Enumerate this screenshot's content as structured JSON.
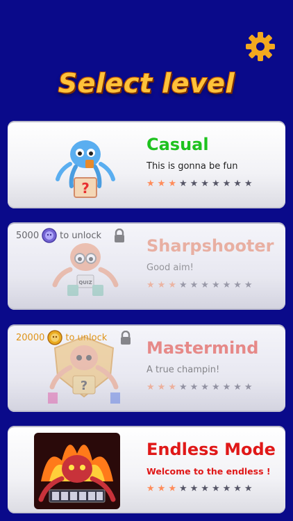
{
  "header": {
    "title": "Select level",
    "settings_icon": "gear-icon",
    "title_color": "#ffc23a"
  },
  "levels": [
    {
      "name": "Casual",
      "description": "This is gonna be fun",
      "name_color": "#1fc21f",
      "desc_color": "#222222",
      "difficulty_stars": 3,
      "total_stars": 10,
      "locked": false,
      "unlock_cost": "",
      "unlock_text": "",
      "icon": "octopus-box-icon"
    },
    {
      "name": "Sharpshooter",
      "description": "Good aim!",
      "name_color": "#f2b6a4",
      "desc_color": "#9a9a9a",
      "difficulty_stars": 3,
      "total_stars": 10,
      "locked": true,
      "unlock_cost": "5000",
      "unlock_text": "to unlock",
      "unlock_color": "#6a6a6a",
      "coin_icon": "purple-coin-icon",
      "icon": "octopus-quiz-icon"
    },
    {
      "name": "Mastermind",
      "description": "A true champin!",
      "name_color": "#ef8f88",
      "desc_color": "#8a8a8a",
      "difficulty_stars": 3,
      "total_stars": 10,
      "locked": true,
      "unlock_cost": "20000",
      "unlock_text": "to unlock",
      "unlock_color": "#e89a14",
      "coin_icon": "gold-coin-icon",
      "icon": "octopus-trophy-icon"
    },
    {
      "name": "Endless Mode",
      "description": "Welcome to the endless !",
      "name_color": "#e01818",
      "desc_color": "#e01818",
      "difficulty_stars": 3,
      "total_stars": 10,
      "locked": false,
      "unlock_cost": "",
      "unlock_text": "",
      "icon": "fire-octopus-icon"
    }
  ]
}
